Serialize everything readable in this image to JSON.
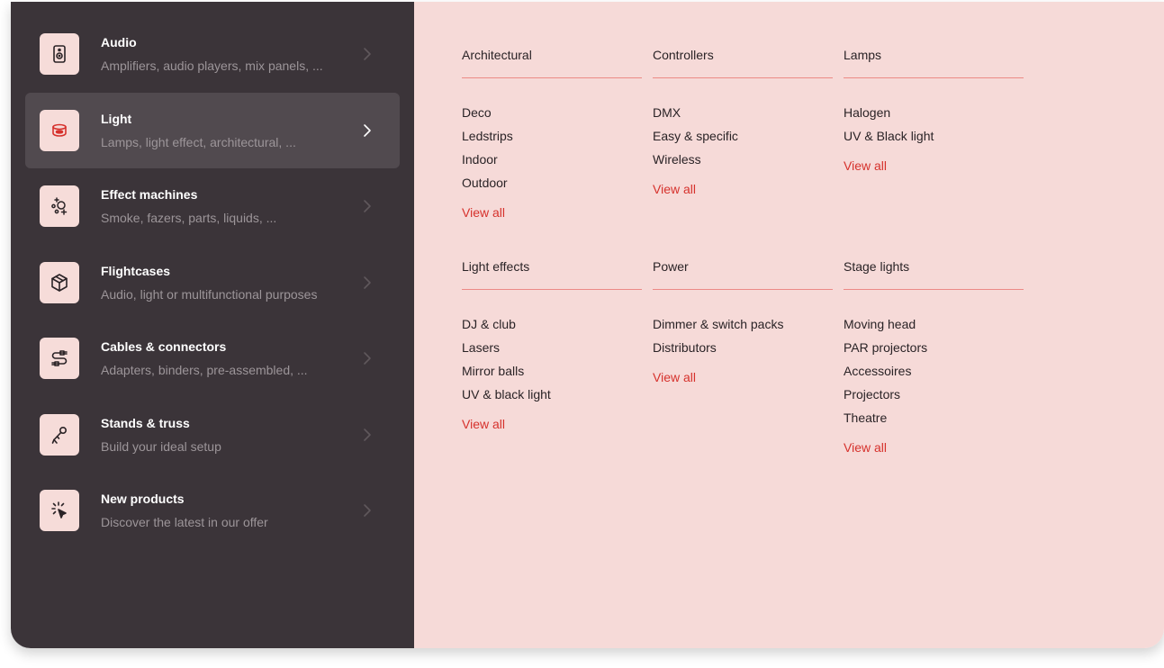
{
  "sidebar": {
    "categories": [
      {
        "title": "Audio",
        "subtitle": "Amplifiers, audio players, mix panels, ...",
        "icon": "speaker-icon"
      },
      {
        "title": "Light",
        "subtitle": "Lamps, light effect, architectural, ...",
        "icon": "lamp-icon"
      },
      {
        "title": "Effect machines",
        "subtitle": "Smoke, fazers, parts, liquids, ...",
        "icon": "effects-icon"
      },
      {
        "title": "Flightcases",
        "subtitle": "Audio, light or multifunctional purposes",
        "icon": "box-icon"
      },
      {
        "title": "Cables & connectors",
        "subtitle": "Adapters, binders, pre-assembled, ...",
        "icon": "cable-icon"
      },
      {
        "title": "Stands & truss",
        "subtitle": "Build your ideal setup",
        "icon": "microphone-stand-icon"
      },
      {
        "title": "New products",
        "subtitle": "Discover the latest in our offer",
        "icon": "sparkle-cursor-icon"
      }
    ]
  },
  "panel": {
    "view_all_label": "View all",
    "groups": [
      {
        "title": "Architectural",
        "items": [
          "Deco",
          "Ledstrips",
          "Indoor",
          "Outdoor"
        ]
      },
      {
        "title": "Controllers",
        "items": [
          "DMX",
          "Easy & specific",
          "Wireless"
        ]
      },
      {
        "title": "Lamps",
        "items": [
          "Halogen",
          "UV & Black light"
        ]
      },
      {
        "title": "Light effects",
        "items": [
          "DJ & club",
          "Lasers",
          "Mirror balls",
          "UV & black light"
        ]
      },
      {
        "title": "Power",
        "items": [
          "Dimmer & switch packs",
          "Distributors"
        ]
      },
      {
        "title": "Stage lights",
        "items": [
          "Moving head",
          "PAR projectors",
          "Accessoires",
          "Projectors",
          "Theatre"
        ]
      }
    ]
  },
  "colors": {
    "sidebar_bg": "#3b3439",
    "active_bg": "#514a4f",
    "panel_bg": "#f6dad8",
    "accent": "#d6312c",
    "divider": "#ec8a86"
  }
}
